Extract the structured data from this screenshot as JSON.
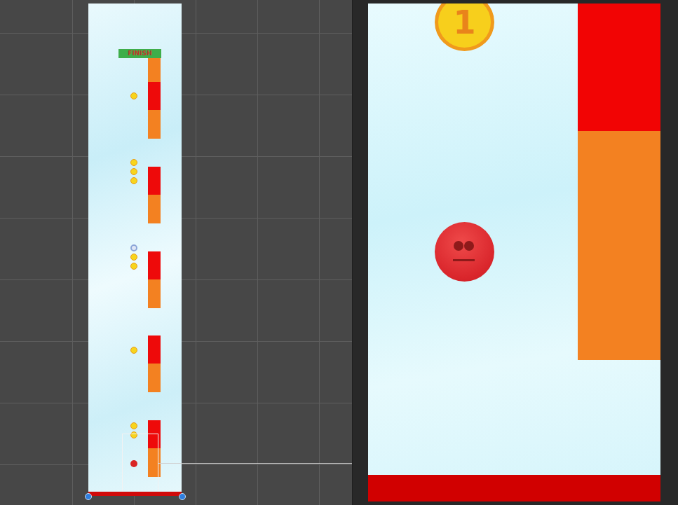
{
  "scene": {
    "finish": {
      "label": "FINISH"
    },
    "sections": [
      {
        "coins": [
          {
            "selected": false
          },
          {
            "selected": false
          }
        ]
      },
      {
        "coins": [
          {
            "selected": false
          }
        ]
      },
      {
        "coins": [
          {
            "selected": true
          },
          {
            "selected": false
          },
          {
            "selected": false
          }
        ]
      },
      {
        "coins": [
          {
            "selected": false
          },
          {
            "selected": false
          },
          {
            "selected": false
          }
        ]
      },
      {
        "coins": [
          {
            "selected": false
          }
        ]
      }
    ],
    "player": {
      "selected": true
    }
  },
  "game": {
    "coin": {
      "value": "1"
    }
  }
}
